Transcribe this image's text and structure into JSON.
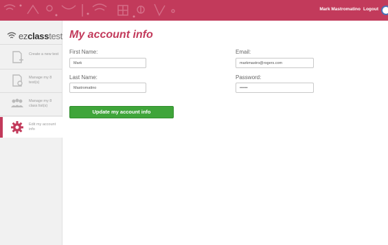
{
  "topbar": {
    "user_name": "Mark Mastromatino",
    "logout_label": "Logout"
  },
  "sidebar": {
    "logo": {
      "part1": "ez",
      "part2": "class",
      "part3": "test"
    },
    "items": [
      {
        "label": "Create a new test",
        "icon": "new-test-icon"
      },
      {
        "label": "Manage my 8 test(s)",
        "icon": "manage-tests-icon"
      },
      {
        "label": "Manage my 8 class list(s)",
        "icon": "class-list-icon"
      },
      {
        "label": "Edit my account info",
        "icon": "gear-icon"
      }
    ]
  },
  "main": {
    "title": "My account info",
    "first_name": {
      "label": "First Name:",
      "value": "Mark"
    },
    "last_name": {
      "label": "Last Name:",
      "value": "Mastromatino"
    },
    "email": {
      "label": "Email:",
      "value": "markmastro@rogers.com"
    },
    "password": {
      "label": "Password:",
      "value": "••••••"
    },
    "update_button": "Update my account info"
  },
  "colors": {
    "accent": "#c23a5b",
    "button": "#3fa53a",
    "sidebar_bg": "#f1f1f1"
  }
}
